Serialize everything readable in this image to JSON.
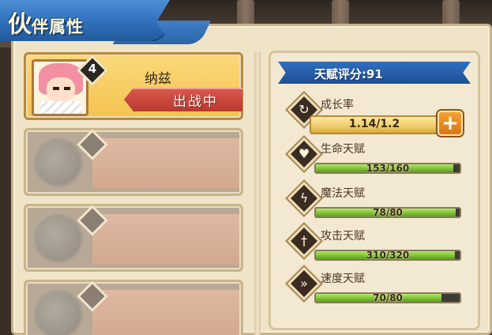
{
  "title": {
    "first_char": "伙",
    "rest": "伴属性"
  },
  "partners": {
    "active": {
      "level": "4",
      "name": "纳兹",
      "status": "出战中"
    }
  },
  "talents": {
    "score_label": "天赋评分:91",
    "growth": {
      "label": "成长率",
      "value": "1.14/1.2",
      "plus": "+"
    },
    "stats": [
      {
        "label": "生命天赋",
        "value": "153/160",
        "fill": 0.956,
        "icon": "heart-icon",
        "glyph": "♥"
      },
      {
        "label": "魔法天赋",
        "value": "78/80",
        "fill": 0.975,
        "icon": "lightning-icon",
        "glyph": "ϟ"
      },
      {
        "label": "攻击天赋",
        "value": "310/320",
        "fill": 0.969,
        "icon": "sword-icon",
        "glyph": "†"
      },
      {
        "label": "速度天赋",
        "value": "70/80",
        "fill": 0.875,
        "icon": "boot-icon",
        "glyph": "»"
      }
    ]
  },
  "colors": {
    "banner_blue": "#2f6fba",
    "active_slot": "#f4c350",
    "status_red": "#c9443b",
    "bar_green": "#7fc236"
  }
}
